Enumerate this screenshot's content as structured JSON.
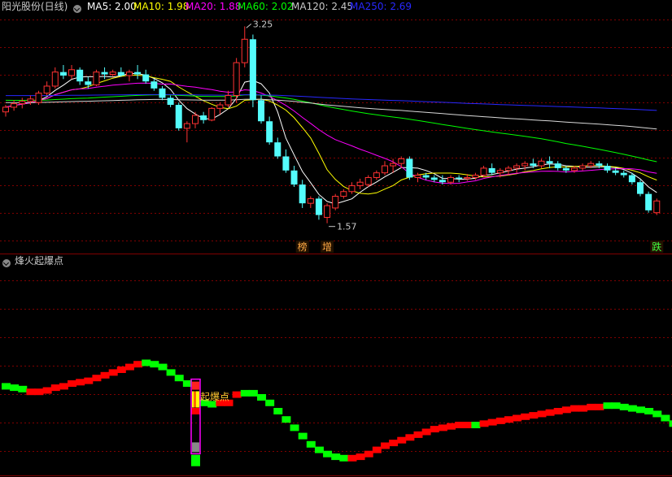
{
  "colors": {
    "up": "#ff3232",
    "down": "#54fcfc",
    "grid": "#800000",
    "ma5": "#ffffff",
    "ma10": "#ffff00",
    "ma20": "#ff00ff",
    "ma60": "#00ff00",
    "ma120": "#d8d8d8",
    "ma250": "#2828ff",
    "ind_up": "#ff0000",
    "ind_down": "#00ff00",
    "text": "#c8c8c8"
  },
  "header": {
    "title": "阳光股份(日线)",
    "ma5": "MA5: 2.00",
    "ma10": "MA10: 1.98",
    "ma20": "MA20: 1.88",
    "ma60": "MA60: 2.02",
    "ma120": "MA120: 2.45",
    "ma250": "MA250: 2.69",
    "indicator_title": "烽火起爆点"
  },
  "chart_data": [
    {
      "type": "candlestick",
      "ylim": [
        1.45,
        3.35
      ],
      "annotations": {
        "high": "3.25",
        "low": "1.57",
        "markers": [
          "榜",
          "增",
          "跌"
        ]
      },
      "candles": [
        [
          2.52,
          2.58,
          2.48,
          2.56
        ],
        [
          2.56,
          2.62,
          2.53,
          2.59
        ],
        [
          2.59,
          2.64,
          2.55,
          2.61
        ],
        [
          2.61,
          2.66,
          2.58,
          2.63
        ],
        [
          2.6,
          2.7,
          2.58,
          2.68
        ],
        [
          2.68,
          2.78,
          2.66,
          2.74
        ],
        [
          2.74,
          2.9,
          2.72,
          2.86
        ],
        [
          2.86,
          2.92,
          2.8,
          2.83
        ],
        [
          2.83,
          2.92,
          2.8,
          2.88
        ],
        [
          2.88,
          2.9,
          2.75,
          2.78
        ],
        [
          2.78,
          2.82,
          2.72,
          2.75
        ],
        [
          2.75,
          2.88,
          2.74,
          2.86
        ],
        [
          2.86,
          2.9,
          2.8,
          2.84
        ],
        [
          2.84,
          2.88,
          2.82,
          2.86
        ],
        [
          2.86,
          2.9,
          2.82,
          2.83
        ],
        [
          2.83,
          2.88,
          2.78,
          2.86
        ],
        [
          2.86,
          2.92,
          2.8,
          2.84
        ],
        [
          2.84,
          2.88,
          2.76,
          2.78
        ],
        [
          2.78,
          2.8,
          2.7,
          2.72
        ],
        [
          2.72,
          2.74,
          2.62,
          2.64
        ],
        [
          2.64,
          2.66,
          2.56,
          2.58
        ],
        [
          2.58,
          2.6,
          2.36,
          2.38
        ],
        [
          2.38,
          2.44,
          2.26,
          2.42
        ],
        [
          2.42,
          2.52,
          2.38,
          2.49
        ],
        [
          2.49,
          2.52,
          2.42,
          2.45
        ],
        [
          2.45,
          2.56,
          2.44,
          2.55
        ],
        [
          2.55,
          2.6,
          2.5,
          2.58
        ],
        [
          2.58,
          2.7,
          2.56,
          2.66
        ],
        [
          2.66,
          2.98,
          2.6,
          2.94
        ],
        [
          2.94,
          3.25,
          2.9,
          3.14
        ],
        [
          3.14,
          3.18,
          2.56,
          2.62
        ],
        [
          2.62,
          2.66,
          2.42,
          2.44
        ],
        [
          2.44,
          2.48,
          2.24,
          2.26
        ],
        [
          2.26,
          2.3,
          2.12,
          2.14
        ],
        [
          2.14,
          2.2,
          2.0,
          2.02
        ],
        [
          2.02,
          2.06,
          1.88,
          1.9
        ],
        [
          1.9,
          1.94,
          1.7,
          1.74
        ],
        [
          1.74,
          1.8,
          1.7,
          1.78
        ],
        [
          1.78,
          1.8,
          1.6,
          1.64
        ],
        [
          1.62,
          1.74,
          1.57,
          1.72
        ],
        [
          1.7,
          1.82,
          1.68,
          1.8
        ],
        [
          1.8,
          1.86,
          1.78,
          1.84
        ],
        [
          1.84,
          1.92,
          1.82,
          1.89
        ],
        [
          1.89,
          1.95,
          1.86,
          1.92
        ],
        [
          1.9,
          1.98,
          1.88,
          1.96
        ],
        [
          1.96,
          2.02,
          1.94,
          2.0
        ],
        [
          2.0,
          2.1,
          1.98,
          2.06
        ],
        [
          2.06,
          2.12,
          2.0,
          2.08
        ],
        [
          2.08,
          2.14,
          2.04,
          2.12
        ],
        [
          2.12,
          2.14,
          1.94,
          1.96
        ],
        [
          1.96,
          2.0,
          1.92,
          1.98
        ],
        [
          1.98,
          2.0,
          1.94,
          1.96
        ],
        [
          1.96,
          1.98,
          1.92,
          1.94
        ],
        [
          1.94,
          1.98,
          1.9,
          1.92
        ],
        [
          1.92,
          1.98,
          1.9,
          1.96
        ],
        [
          1.96,
          1.98,
          1.92,
          1.95
        ],
        [
          1.95,
          1.99,
          1.93,
          1.96
        ],
        [
          1.96,
          2.0,
          1.94,
          1.98
        ],
        [
          1.98,
          2.06,
          1.96,
          2.04
        ],
        [
          2.04,
          2.08,
          1.98,
          2.0
        ],
        [
          2.0,
          2.04,
          1.96,
          2.02
        ],
        [
          2.02,
          2.06,
          1.98,
          2.04
        ],
        [
          2.04,
          2.08,
          2.0,
          2.06
        ],
        [
          2.06,
          2.1,
          2.02,
          2.08
        ],
        [
          2.08,
          2.12,
          2.04,
          2.06
        ],
        [
          2.06,
          2.12,
          2.04,
          2.1
        ],
        [
          2.1,
          2.14,
          2.04,
          2.08
        ],
        [
          2.08,
          2.1,
          2.02,
          2.04
        ],
        [
          2.04,
          2.06,
          2.0,
          2.02
        ],
        [
          2.02,
          2.06,
          2.0,
          2.04
        ],
        [
          2.04,
          2.08,
          2.02,
          2.06
        ],
        [
          2.06,
          2.1,
          2.04,
          2.08
        ],
        [
          2.08,
          2.1,
          2.04,
          2.06
        ],
        [
          2.06,
          2.08,
          2.0,
          2.02
        ],
        [
          2.02,
          2.04,
          1.98,
          2.0
        ],
        [
          2.0,
          2.02,
          1.96,
          1.98
        ],
        [
          1.98,
          2.0,
          1.9,
          1.92
        ],
        [
          1.92,
          1.94,
          1.8,
          1.82
        ],
        [
          1.82,
          1.84,
          1.66,
          1.68
        ],
        [
          1.66,
          1.78,
          1.64,
          1.76
        ]
      ]
    },
    {
      "type": "indicator",
      "ylim": [
        0,
        100
      ],
      "label": "起爆点",
      "values": [
        58,
        57,
        56,
        54,
        54,
        55,
        57,
        58,
        60,
        61,
        62,
        64,
        66,
        68,
        70,
        72,
        74,
        75,
        74,
        72,
        68,
        64,
        60,
        40,
        46,
        45,
        46,
        46,
        52,
        53,
        53,
        50,
        46,
        40,
        34,
        28,
        22,
        16,
        12,
        9,
        7,
        6,
        6,
        7,
        9,
        12,
        15,
        17,
        19,
        21,
        23,
        25,
        27,
        28,
        29,
        30,
        30,
        30,
        31,
        32,
        33,
        34,
        35,
        36,
        37,
        38,
        39,
        40,
        41,
        42,
        42,
        43,
        43,
        44,
        44,
        43,
        42,
        41,
        40,
        38,
        35,
        31
      ],
      "dirs": [
        0,
        0,
        0,
        1,
        1,
        1,
        1,
        1,
        1,
        1,
        1,
        1,
        1,
        1,
        1,
        1,
        1,
        0,
        0,
        0,
        0,
        0,
        0,
        1,
        0,
        0,
        1,
        1,
        1,
        0,
        0,
        0,
        0,
        0,
        0,
        0,
        0,
        0,
        0,
        0,
        0,
        0,
        1,
        1,
        1,
        1,
        1,
        1,
        1,
        1,
        1,
        1,
        1,
        1,
        1,
        1,
        1,
        0,
        1,
        1,
        1,
        1,
        1,
        1,
        1,
        1,
        1,
        1,
        1,
        1,
        1,
        1,
        1,
        0,
        0,
        0,
        0,
        0,
        0,
        0,
        0,
        0
      ]
    }
  ]
}
